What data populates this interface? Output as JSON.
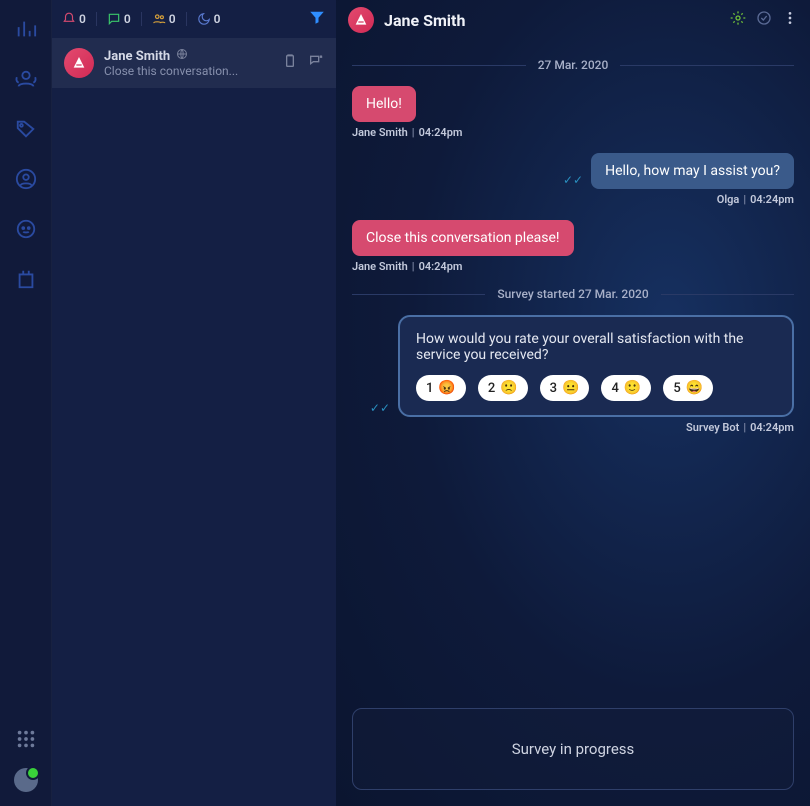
{
  "rail": {
    "icons": [
      "chart-icon",
      "agent-icon",
      "tag-icon",
      "user-icon",
      "bot-icon",
      "plugin-icon"
    ]
  },
  "stats": {
    "bell": "0",
    "chat": "0",
    "group": "0",
    "moon": "0"
  },
  "conversations": [
    {
      "name": "Jane Smith",
      "preview": "Close this conversation..."
    }
  ],
  "header": {
    "name": "Jane Smith"
  },
  "thread": {
    "date": "27 Mar. 2020",
    "msg1": {
      "text": "Hello!",
      "sender": "Jane Smith",
      "time": "04:24pm"
    },
    "msg2": {
      "text": "Hello, how may I assist you?",
      "sender": "Olga",
      "time": "04:24pm"
    },
    "msg3": {
      "text": "Close this conversation please!",
      "sender": "Jane Smith",
      "time": "04:24pm"
    },
    "survey_divider": "Survey started 27 Mar. 2020",
    "survey": {
      "question": "How would you rate your overall satisfaction with the service you received?",
      "options": [
        {
          "n": "1",
          "emoji": "😡"
        },
        {
          "n": "2",
          "emoji": "🙁"
        },
        {
          "n": "3",
          "emoji": "😐"
        },
        {
          "n": "4",
          "emoji": "🙂"
        },
        {
          "n": "5",
          "emoji": "😄"
        }
      ],
      "sender": "Survey Bot",
      "time": "04:24pm"
    }
  },
  "footer": {
    "text": "Survey in progress"
  }
}
